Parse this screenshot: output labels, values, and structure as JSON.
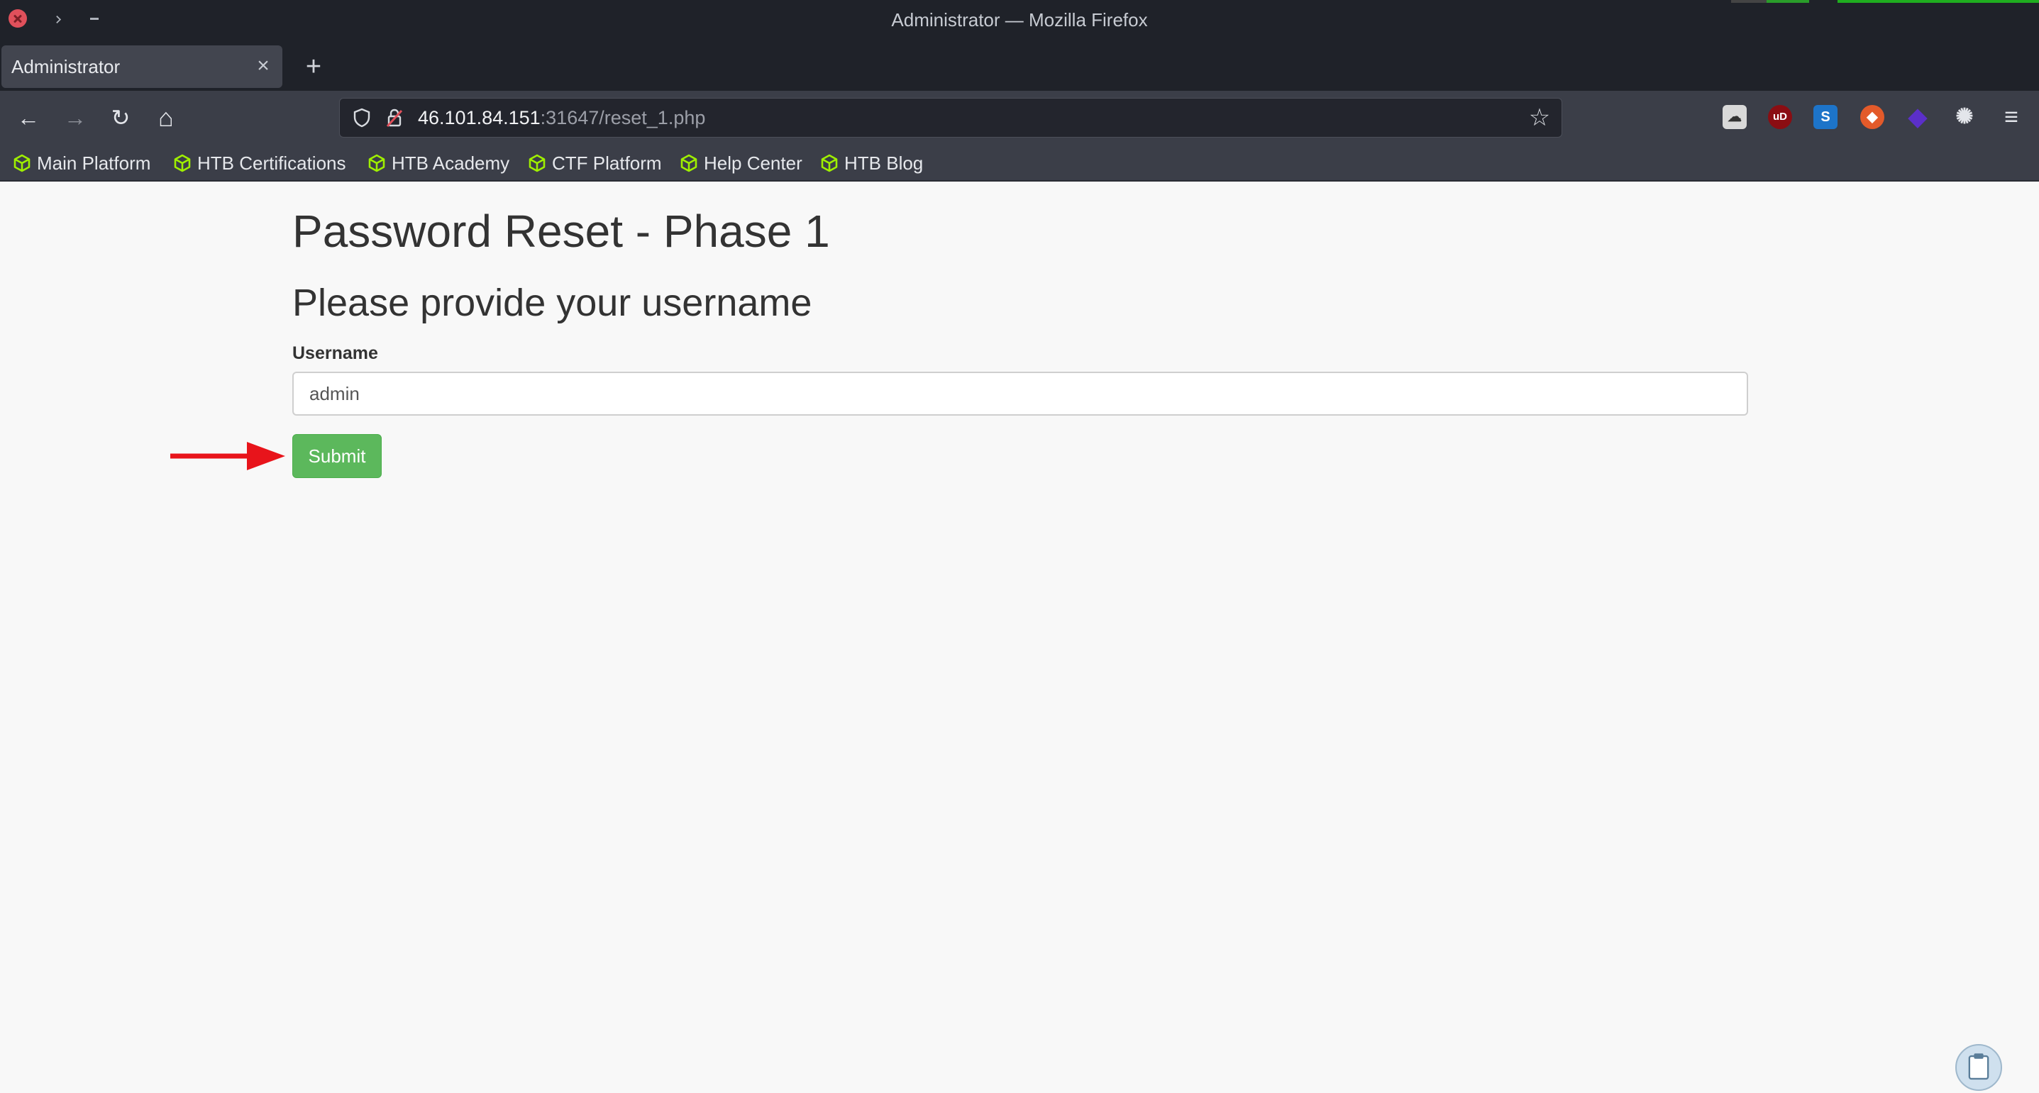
{
  "window": {
    "title": "Administrator — Mozilla Firefox"
  },
  "tabs": [
    {
      "label": "Administrator",
      "close_glyph": "×"
    }
  ],
  "new_tab_glyph": "+",
  "nav": {
    "back_glyph": "←",
    "forward_glyph": "→",
    "reload_glyph": "↻",
    "home_glyph": "⌂",
    "url_host": "46.101.84.151",
    "url_rest": ":31647/reset_1.php",
    "bookmark_star_glyph": "☆",
    "menu_glyph": "≡"
  },
  "extensions": [
    {
      "name": "extension-1-icon"
    },
    {
      "name": "ublock-icon",
      "label": "uD"
    },
    {
      "name": "s-extension-icon",
      "label": "S"
    },
    {
      "name": "fox-extension-icon"
    },
    {
      "name": "purple-gem-icon"
    },
    {
      "name": "cookie-icon"
    }
  ],
  "bookmarks": [
    {
      "label": "Main Platform"
    },
    {
      "label": "HTB Certifications"
    },
    {
      "label": "HTB Academy"
    },
    {
      "label": "CTF Platform"
    },
    {
      "label": "Help Center"
    },
    {
      "label": "HTB Blog"
    }
  ],
  "page": {
    "heading": "Password Reset - Phase 1",
    "subheading": "Please provide your username",
    "username_label": "Username",
    "username_value": "admin",
    "submit_label": "Submit"
  },
  "colors": {
    "submit_green": "#5cb85c",
    "annotation_arrow": "#e8141b",
    "bookmark_cube": "#9fef00"
  }
}
